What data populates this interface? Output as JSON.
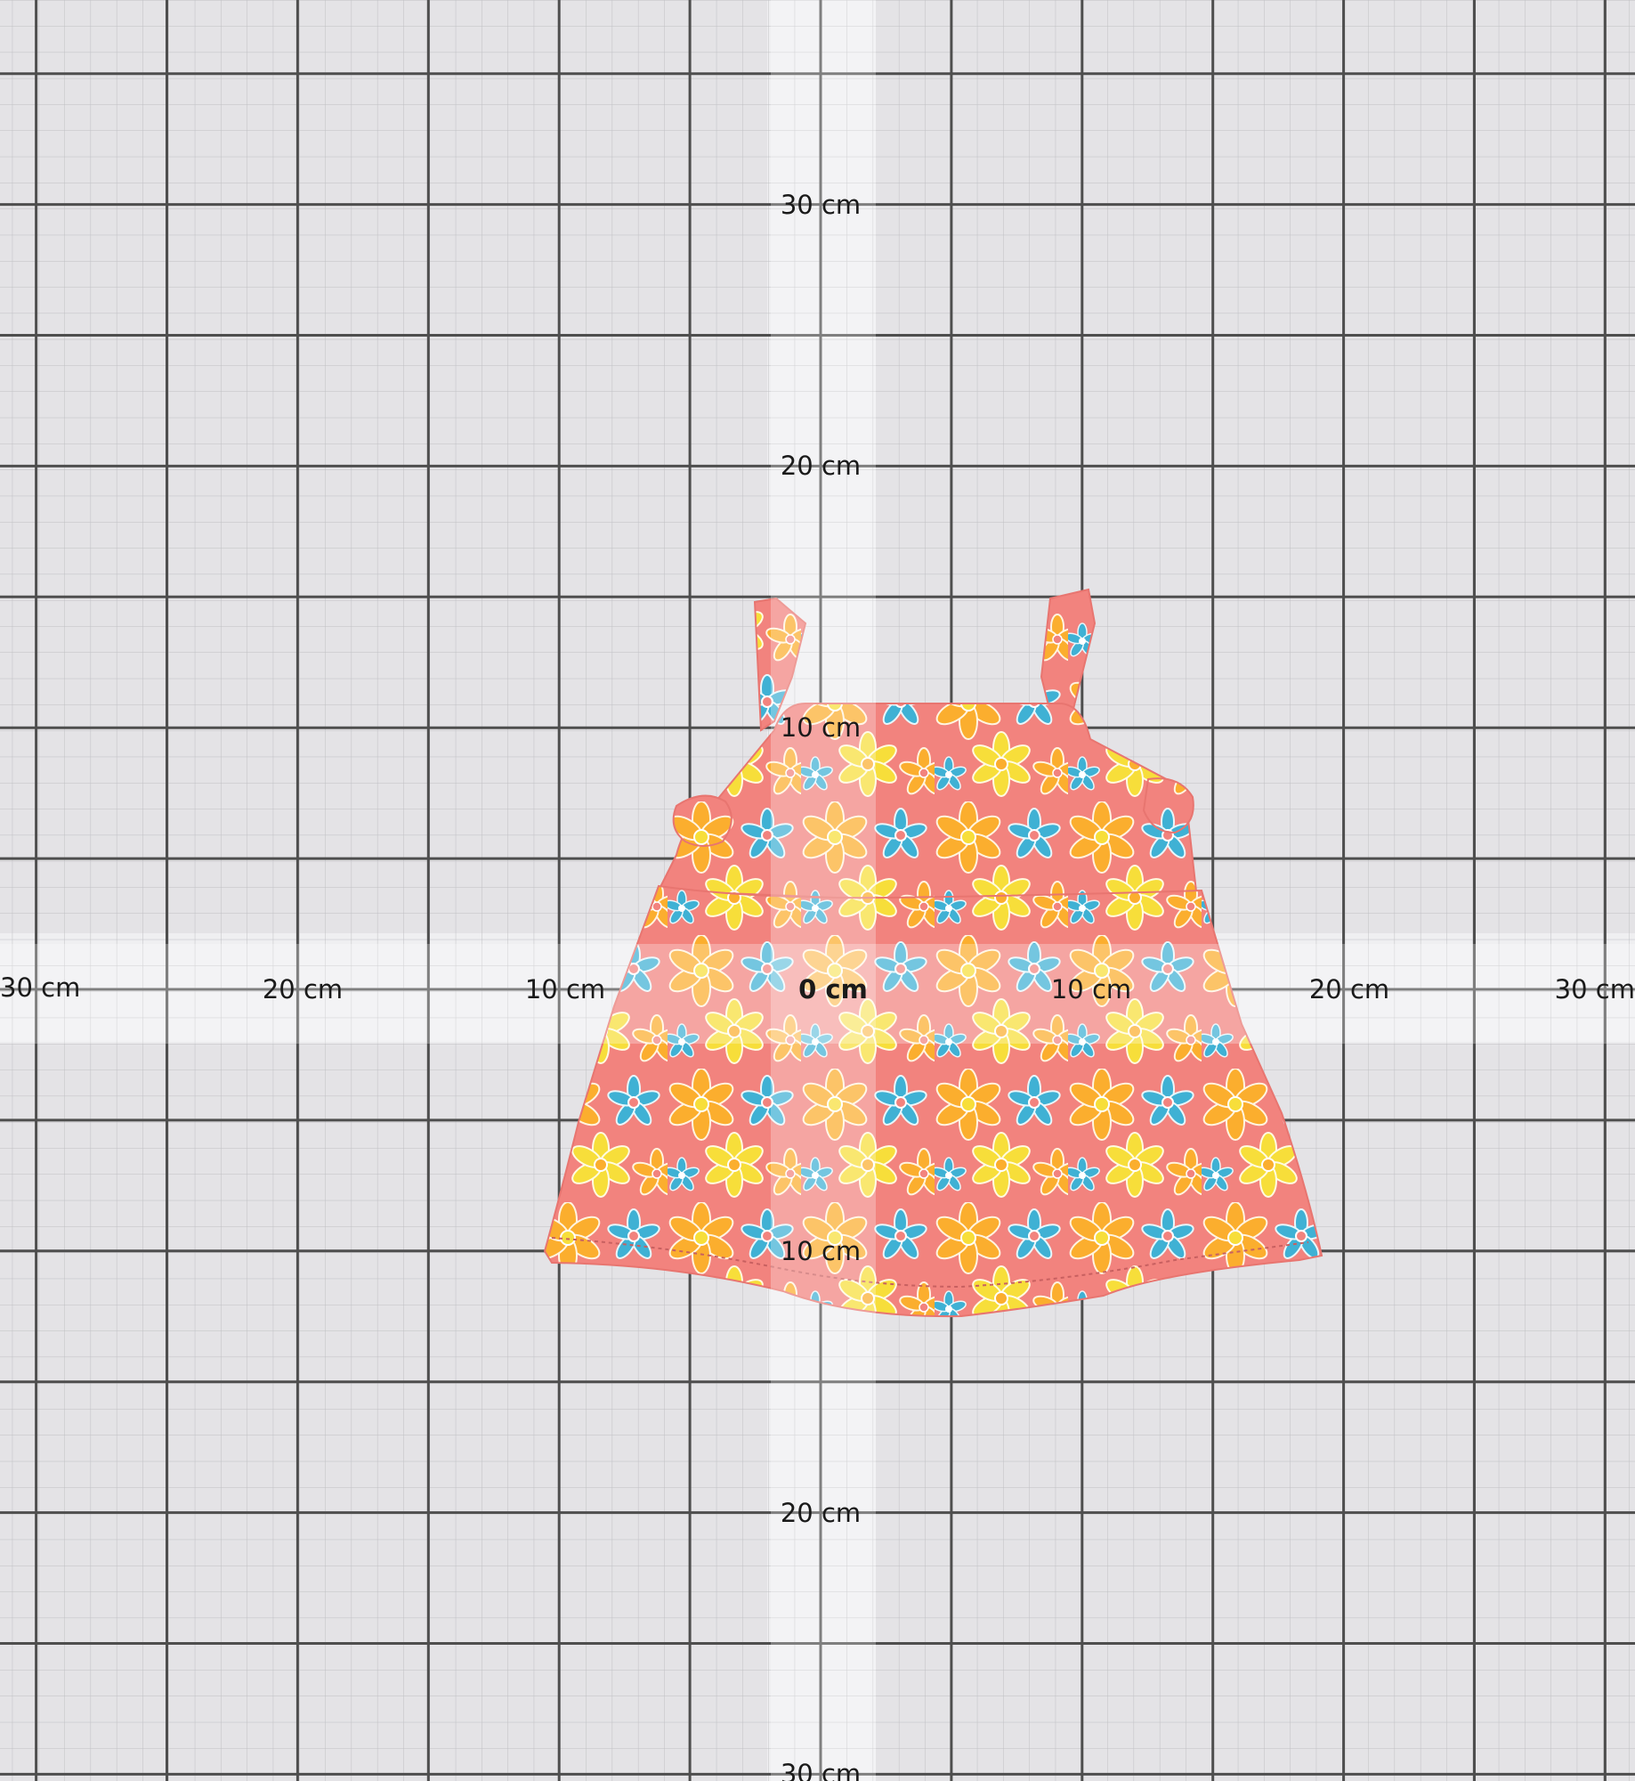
{
  "measurement_board": {
    "unit": "cm",
    "origin_label": "0 cm",
    "horizontal_labels": [
      "30 cm",
      "20 cm",
      "10 cm",
      "10 cm",
      "20 cm",
      "30 cm"
    ],
    "vertical_labels": [
      "30 cm",
      "20 cm",
      "10 cm",
      "10 cm",
      "20 cm",
      "30 cm"
    ]
  },
  "garment": {
    "type": "sleeveless-dress",
    "pattern": "floral",
    "pattern_colors": {
      "base": "#f2837e",
      "blue": "#3fb1d4",
      "yellow": "#f7de3a",
      "orange": "#fbae2e"
    }
  },
  "colors": {
    "board_background": "#e4e3e6",
    "major_grid": "#4e4e4e",
    "minor_grid": "#b9b9bc",
    "axis_band": "#f1f1f3"
  }
}
